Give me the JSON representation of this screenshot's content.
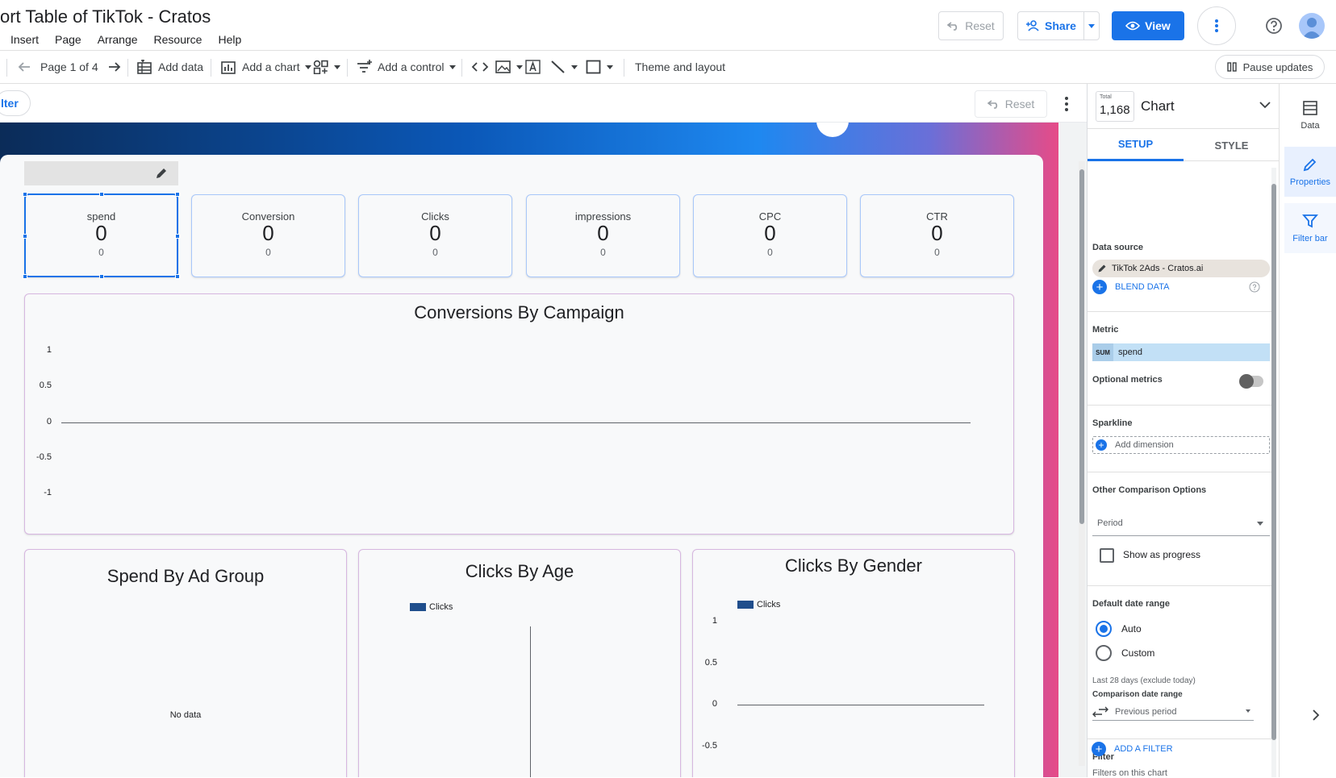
{
  "app": {
    "title": "ort Table of TikTok  - Cratos",
    "menu": [
      "Insert",
      "Page",
      "Arrange",
      "Resource",
      "Help"
    ],
    "reset_label": "Reset",
    "share_label": "Share",
    "view_label": "View"
  },
  "toolbar": {
    "page_label": "Page 1 of 4",
    "add_data": "Add data",
    "add_chart": "Add a chart",
    "add_control": "Add a control",
    "theme_layout": "Theme and layout",
    "pause_updates": "Pause updates"
  },
  "canvas": {
    "filter_chip": "lter",
    "reset_label": "Reset",
    "kpis": [
      {
        "label": "spend",
        "value": "0",
        "comparison": "0"
      },
      {
        "label": "Conversion",
        "value": "0",
        "comparison": "0"
      },
      {
        "label": "Clicks",
        "value": "0",
        "comparison": "0"
      },
      {
        "label": "impressions",
        "value": "0",
        "comparison": "0"
      },
      {
        "label": "CPC",
        "value": "0",
        "comparison": "0"
      },
      {
        "label": "CTR",
        "value": "0",
        "comparison": "0"
      }
    ],
    "charts": {
      "conversions": {
        "title": "Conversions By Campaign",
        "ticks": [
          "1",
          "0.5",
          "0",
          "-0.5",
          "-1"
        ]
      },
      "spend": {
        "title": "Spend By Ad Group",
        "empty": "No data"
      },
      "age": {
        "title": "Clicks By Age",
        "legend": "Clicks"
      },
      "gender": {
        "title": "Clicks By Gender",
        "legend": "Clicks",
        "ticks": [
          "1",
          "0.5",
          "0",
          "-0.5"
        ]
      }
    }
  },
  "chart_data": [
    {
      "type": "line",
      "title": "Conversions By Campaign",
      "ylim": [
        -1,
        1
      ],
      "yticks": [
        1,
        0.5,
        0,
        -0.5,
        -1
      ],
      "series": []
    },
    {
      "type": "bar",
      "title": "Spend By Ad Group",
      "series": [],
      "note": "No data"
    },
    {
      "type": "bar",
      "title": "Clicks By Age",
      "legend": [
        "Clicks"
      ],
      "series": [
        {
          "name": "Clicks",
          "values": []
        }
      ]
    },
    {
      "type": "bar",
      "title": "Clicks By Gender",
      "legend": [
        "Clicks"
      ],
      "ylim": [
        -0.5,
        1
      ],
      "yticks": [
        1,
        0.5,
        0,
        -0.5
      ],
      "series": [
        {
          "name": "Clicks",
          "values": []
        }
      ]
    }
  ],
  "panel": {
    "total_label": "Total",
    "total_value": "1,168",
    "title": "Chart",
    "tabs": [
      "SETUP",
      "STYLE"
    ],
    "data_source_label": "Data source",
    "data_source_value": "TikTok 2Ads - Cratos.ai",
    "blend_data": "BLEND DATA",
    "metric_label": "Metric",
    "metric_agg": "SUM",
    "metric_value": "spend",
    "optional_metrics": "Optional metrics",
    "sparkline_label": "Sparkline",
    "add_dimension": "Add dimension",
    "other_comparison": "Other Comparison Options",
    "period_placeholder": "Period",
    "show_progress": "Show as progress",
    "default_date_range": "Default date range",
    "radio_auto": "Auto",
    "radio_custom": "Custom",
    "last_28": "Last 28 days (exclude today)",
    "comparison_range_label": "Comparison date range",
    "comparison_range_value": "Previous period",
    "filter_label": "Filter",
    "filters_on_chart": "Filters on this chart",
    "add_filter": "ADD A FILTER"
  },
  "rail": {
    "items": [
      "Data",
      "Properties",
      "Filter bar"
    ]
  },
  "colors": {
    "accent": "#1a73e8",
    "legend_swatch": "#1f4e8c"
  }
}
